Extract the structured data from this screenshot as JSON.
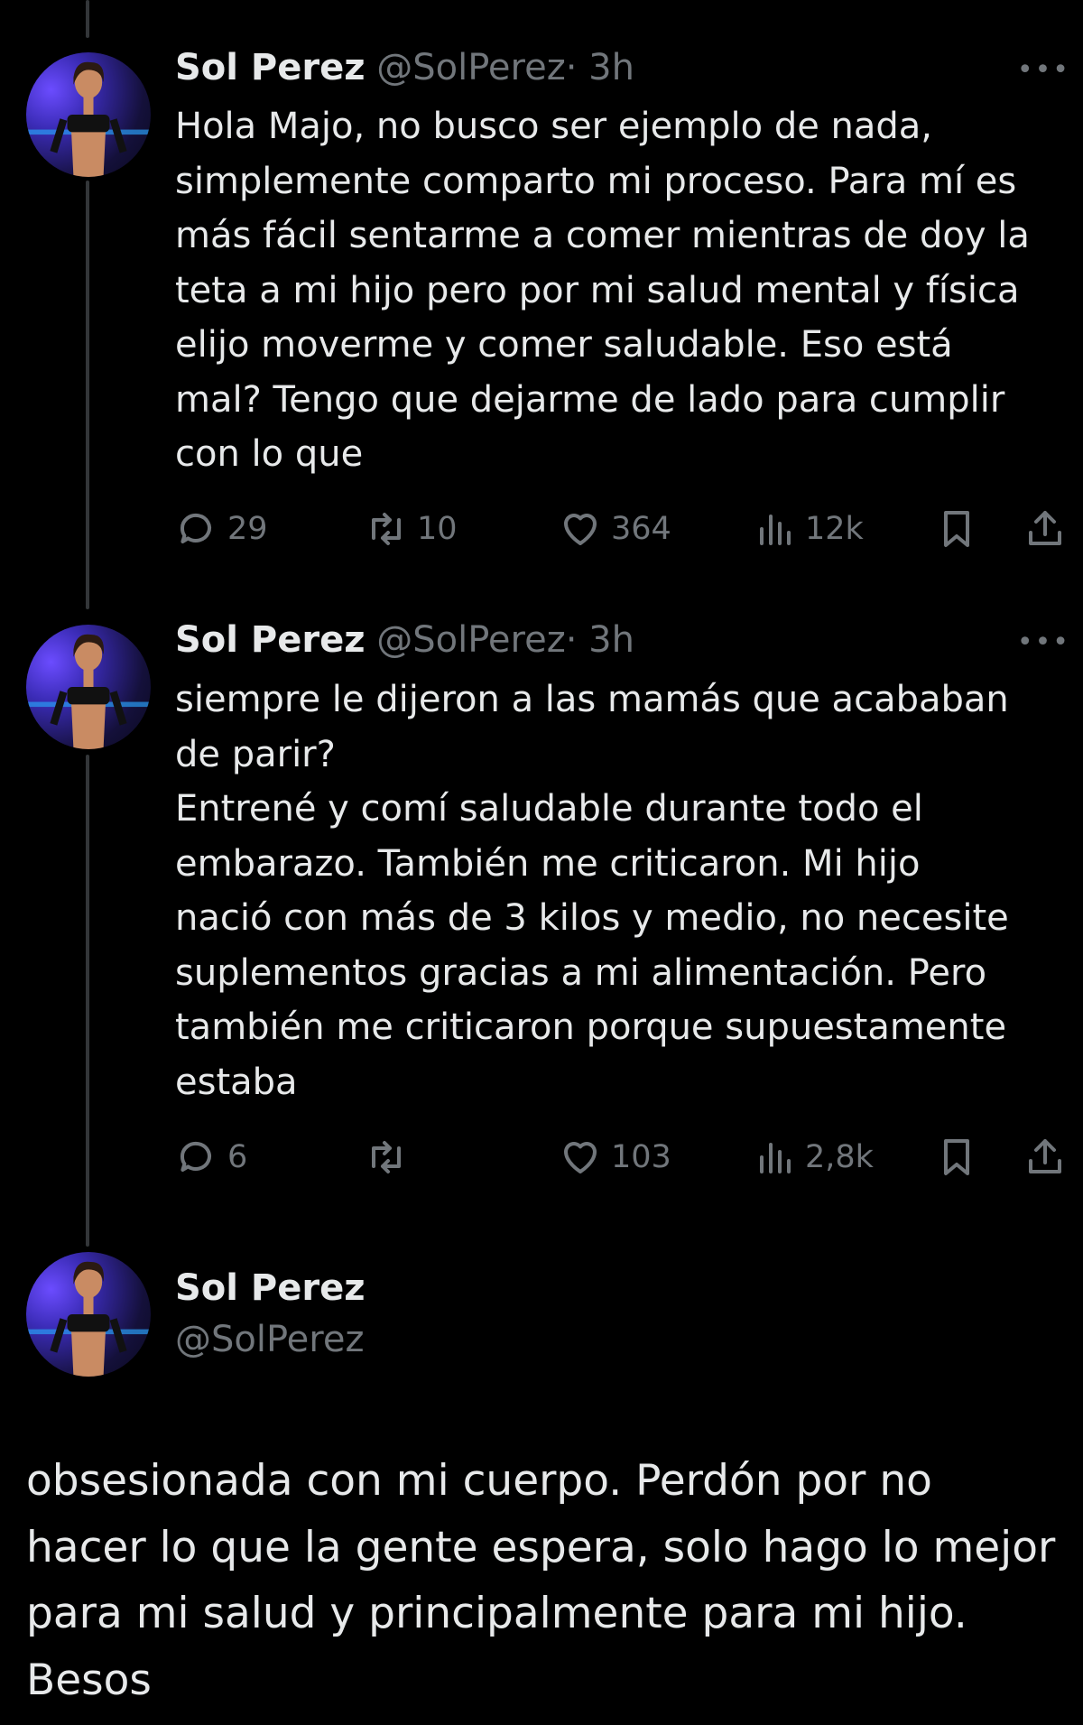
{
  "tweets": [
    {
      "name": "Sol Perez",
      "handle": "@SolPerez",
      "time": "· 3h",
      "more": "•••",
      "text": "Hola Majo, no busco ser ejemplo de nada,\nsimplemente comparto mi proceso. Para mí es\nmás fácil sentarme a comer mientras de doy la\nteta a mi hijo pero por mi salud mental y física\nelijo moverme y comer saludable. Eso está\nmal? Tengo que dejarme de lado para cumplir\ncon lo que",
      "stats": {
        "replies": "29",
        "retweets": "10",
        "likes": "364",
        "views": "12k"
      }
    },
    {
      "name": "Sol Perez",
      "handle": "@SolPerez",
      "time": "· 3h",
      "more": "•••",
      "text": "siempre le dijeron a las mamás que acababan\nde parir?\nEntrené y comí saludable durante todo el\nembarazo. También me criticaron. Mi hijo\nnació con más de 3 kilos y medio, no necesite\nsuplementos gracias a mi alimentación. Pero\ntambién me criticaron porque supuestamente\nestaba",
      "stats": {
        "replies": "6",
        "retweets": "",
        "likes": "103",
        "views": "2,8k"
      }
    }
  ],
  "main_tweet": {
    "name": "Sol Perez",
    "handle": "@SolPerez",
    "text": "obsesionada con mi cuerpo. Perdón por no\nhacer lo que la gente espera, solo hago lo mejor\npara mi salud y principalmente para mi hijo.\nBesos"
  },
  "icons": [
    "reply-icon",
    "retweet-icon",
    "like-icon",
    "views-icon",
    "bookmark-icon",
    "share-icon",
    "more-icon"
  ],
  "colors": {
    "background": "#000000",
    "text": "#e7e9ea",
    "secondary": "#71767b",
    "thread_line": "#333639"
  }
}
